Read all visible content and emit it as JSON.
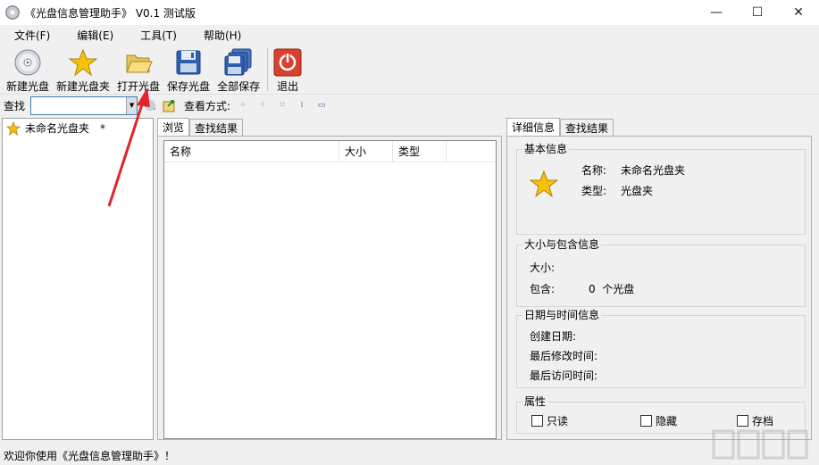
{
  "window": {
    "title": "《光盘信息管理助手》 V0.1 测试版",
    "controls": {
      "minimize": "—",
      "maximize": "☐",
      "close": "✕"
    }
  },
  "menu": [
    "文件(F)",
    "编辑(E)",
    "工具(T)",
    "帮助(H)"
  ],
  "toolbar": {
    "new_disc": "新建光盘",
    "new_folder": "新建光盘夹",
    "open_disc": "打开光盘",
    "save_disc": "保存光盘",
    "save_all": "全部保存",
    "exit": "退出"
  },
  "search": {
    "label": "查找",
    "value": "",
    "view_label": "查看方式:"
  },
  "tree": {
    "items": [
      {
        "label": "未命名光盘夹",
        "mark": "*"
      }
    ]
  },
  "middle": {
    "tabs": [
      "浏览",
      "查找结果"
    ],
    "columns": [
      "名称",
      "大小",
      "类型"
    ]
  },
  "right": {
    "tabs": [
      "详细信息",
      "查找结果"
    ],
    "basic": {
      "title": "基本信息",
      "name_label": "名称:",
      "name_value": "未命名光盘夹",
      "type_label": "类型:",
      "type_value": "光盘夹"
    },
    "size": {
      "title": "大小与包含信息",
      "size_label": "大小:",
      "size_value": "",
      "contains_label": "包含:",
      "contains_value": "0  个光盘"
    },
    "datetime": {
      "title": "日期与时间信息",
      "created_label": "创建日期:",
      "modified_label": "最后修改时间:",
      "accessed_label": "最后访问时间:"
    },
    "attributes": {
      "title": "属性",
      "readonly": "只读",
      "hidden": "隐藏",
      "archive": "存档"
    }
  },
  "status": "欢迎你使用《光盘信息管理助手》！",
  "colors": {
    "annotation_arrow": "#e0242a",
    "exit_icon": "#d9412f",
    "star": "#f4c20d"
  }
}
